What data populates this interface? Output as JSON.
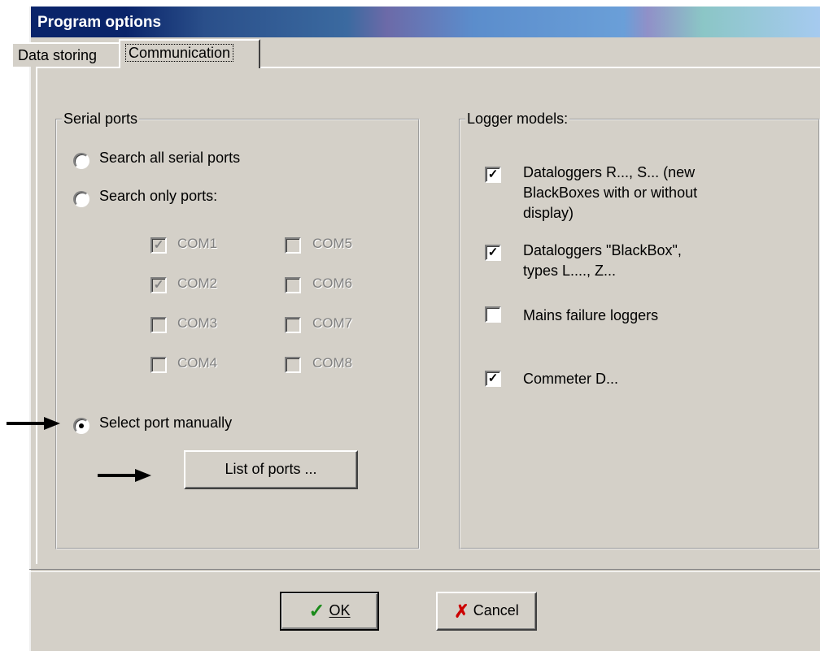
{
  "window": {
    "title": "Program options"
  },
  "tabs": [
    {
      "label": "Data storing",
      "active": false
    },
    {
      "label": "Communication",
      "active": true
    }
  ],
  "serial_ports": {
    "legend": "Serial ports",
    "options": [
      {
        "label": "Search all serial ports",
        "selected": false
      },
      {
        "label": "Search only ports:",
        "selected": false
      },
      {
        "label": "Select port manually",
        "selected": true
      }
    ],
    "ports": [
      {
        "label": "COM1",
        "checked": true,
        "enabled": false
      },
      {
        "label": "COM2",
        "checked": true,
        "enabled": false
      },
      {
        "label": "COM3",
        "checked": false,
        "enabled": false
      },
      {
        "label": "COM4",
        "checked": false,
        "enabled": false
      },
      {
        "label": "COM5",
        "checked": false,
        "enabled": false
      },
      {
        "label": "COM6",
        "checked": false,
        "enabled": false
      },
      {
        "label": "COM7",
        "checked": false,
        "enabled": false
      },
      {
        "label": "COM8",
        "checked": false,
        "enabled": false
      }
    ],
    "list_button": "List of ports ..."
  },
  "logger_models": {
    "legend": "Logger models:",
    "items": [
      {
        "line1": "Dataloggers R..., S... (new",
        "line2": "BlackBoxes with or without",
        "line3": "display)",
        "checked": true
      },
      {
        "line1": "Dataloggers \"BlackBox\",",
        "line2": "types L...., Z...",
        "checked": true
      },
      {
        "line1": "Mains failure loggers",
        "checked": false
      },
      {
        "line1": "Commeter D...",
        "checked": true
      }
    ]
  },
  "buttons": {
    "ok": "OK",
    "cancel": "Cancel"
  },
  "colors": {
    "ok_icon": "#1a8a1a",
    "cancel_icon": "#cc0000"
  }
}
